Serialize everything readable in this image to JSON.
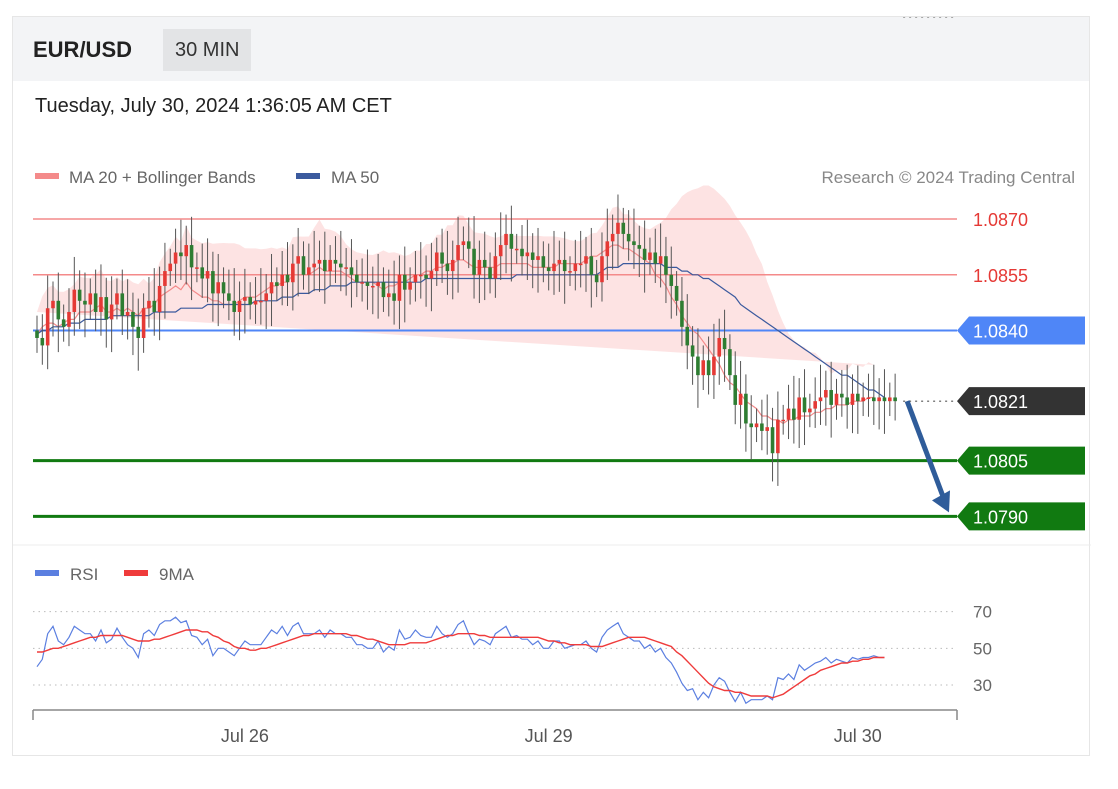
{
  "header": {
    "pair": "EUR/USD",
    "timeframe": "30 MIN",
    "datetime": "Tuesday, July 30, 2024 1:36:05 AM CET"
  },
  "legend": {
    "ma20": "MA 20 + Bollinger Bands",
    "ma50": "MA 50",
    "copyright": "Research © 2024 Trading Central",
    "rsi": "RSI",
    "rsi_ma": "9MA"
  },
  "colors": {
    "candle_up": "#e53935",
    "candle_down": "#2e7d32",
    "ma20": "#f48a8a",
    "band_fill": "#fde0e0",
    "ma50": "#3b5a9e",
    "resistance": "#f48a8a",
    "pivot": "#4f86f7",
    "support": "#117a11",
    "last": "#333333",
    "arrow": "#2f5c9a",
    "rsi": "#5b7fe0",
    "rsi_ma": "#ef3b3b"
  },
  "levels": [
    {
      "value": 1.087,
      "label": "1.0870",
      "type": "resistance"
    },
    {
      "value": 1.0855,
      "label": "1.0855",
      "type": "resistance"
    },
    {
      "value": 1.084,
      "label": "1.0840",
      "type": "pivot"
    },
    {
      "value": 1.0821,
      "label": "1.0821",
      "type": "last"
    },
    {
      "value": 1.0805,
      "label": "1.0805",
      "type": "support"
    },
    {
      "value": 1.079,
      "label": "1.0790",
      "type": "support"
    }
  ],
  "chart_data": [
    {
      "type": "candlestick",
      "title": "EUR/USD",
      "x_ticks": [
        {
          "label": "Jul 26",
          "index": 39
        },
        {
          "label": "Jul 29",
          "index": 96
        },
        {
          "label": "Jul 30",
          "index": 154
        }
      ],
      "ohlc_series": {
        "name": "EUR/USD",
        "closes": [
          1.0838,
          1.0836,
          1.0846,
          1.0848,
          1.0843,
          1.0841,
          1.0845,
          1.0851,
          1.0848,
          1.0847,
          1.085,
          1.0845,
          1.0849,
          1.0843,
          1.0847,
          1.085,
          1.0844,
          1.0845,
          1.0841,
          1.0838,
          1.0846,
          1.0848,
          1.0845,
          1.0852,
          1.0856,
          1.0858,
          1.0861,
          1.086,
          1.0863,
          1.0857,
          1.0857,
          1.0854,
          1.0856,
          1.085,
          1.0853,
          1.085,
          1.0848,
          1.0845,
          1.0848,
          1.0849,
          1.0847,
          1.0848,
          1.0848,
          1.085,
          1.0853,
          1.0852,
          1.0855,
          1.0853,
          1.0858,
          1.086,
          1.0855,
          1.0857,
          1.0858,
          1.0859,
          1.0856,
          1.0859,
          1.0858,
          1.0857,
          1.0857,
          1.0855,
          1.0853,
          1.0853,
          1.0852,
          1.0852,
          1.0853,
          1.0849,
          1.085,
          1.0848,
          1.0855,
          1.0851,
          1.0853,
          1.0855,
          1.0855,
          1.0854,
          1.0856,
          1.0861,
          1.0858,
          1.0856,
          1.0859,
          1.0863,
          1.0864,
          1.0862,
          1.0855,
          1.0859,
          1.0857,
          1.0854,
          1.086,
          1.0863,
          1.0866,
          1.0862,
          1.0862,
          1.086,
          1.0861,
          1.0859,
          1.086,
          1.0857,
          1.0856,
          1.0858,
          1.0859,
          1.0856,
          1.0856,
          1.0858,
          1.0858,
          1.086,
          1.0855,
          1.0853,
          1.086,
          1.0864,
          1.0866,
          1.0869,
          1.0866,
          1.0864,
          1.0863,
          1.0862,
          1.0859,
          1.0861,
          1.0858,
          1.086,
          1.0855,
          1.0852,
          1.0848,
          1.0841,
          1.0836,
          1.0833,
          1.0828,
          1.0832,
          1.0828,
          1.0833,
          1.0838,
          1.0835,
          1.0828,
          1.082,
          1.0823,
          1.0815,
          1.0814,
          1.0815,
          1.0813,
          1.0814,
          1.0807,
          1.0816,
          1.0816,
          1.0819,
          1.0816,
          1.0822,
          1.0818,
          1.0819,
          1.0821,
          1.0822,
          1.0824,
          1.082,
          1.0823,
          1.0822,
          1.082,
          1.0823,
          1.0821,
          1.0822,
          1.0822,
          1.0821,
          1.0822,
          1.0821,
          1.0822,
          1.0821
        ],
        "y_range": [
          1.0778,
          1.0884
        ]
      },
      "lines": [
        {
          "name": "MA 20",
          "values": [
            1.0839,
            1.0841,
            1.0842,
            1.0842,
            1.0841,
            1.0842,
            1.0843,
            1.0843,
            1.0845,
            1.0845,
            1.0845,
            1.0846,
            1.0847,
            1.0845,
            1.0845,
            1.0846,
            1.0845,
            1.0846,
            1.0845,
            1.0844,
            1.0846,
            1.0846,
            1.0847,
            1.0849,
            1.085,
            1.0851,
            1.0852,
            1.0851,
            1.0853,
            1.0851,
            1.085,
            1.0849,
            1.0849,
            1.0848,
            1.0848,
            1.0847,
            1.0847,
            1.0847,
            1.0848,
            1.0849,
            1.0849,
            1.0849,
            1.085,
            1.0851,
            1.0852,
            1.0852,
            1.0853,
            1.0853,
            1.0855,
            1.0855,
            1.0855,
            1.0855,
            1.0856,
            1.0857,
            1.0856,
            1.0856,
            1.0856,
            1.0856,
            1.0855,
            1.0854,
            1.0853,
            1.0853,
            1.0853,
            1.0853,
            1.0852,
            1.0851,
            1.0852,
            1.0852,
            1.0853,
            1.0853,
            1.0854,
            1.0855,
            1.0855,
            1.0856,
            1.0856,
            1.0857,
            1.0857,
            1.0858,
            1.0858,
            1.0859,
            1.0859,
            1.0858,
            1.0857,
            1.0857,
            1.0857,
            1.0857,
            1.0857,
            1.0858,
            1.0858,
            1.0858,
            1.0858,
            1.0858,
            1.0858,
            1.0857,
            1.0857,
            1.0857,
            1.0857,
            1.0857,
            1.0858,
            1.0858,
            1.0858,
            1.0858,
            1.0858,
            1.0859,
            1.086,
            1.086,
            1.0861,
            1.0862,
            1.0863,
            1.0863,
            1.0862,
            1.0862,
            1.0861,
            1.086,
            1.0859,
            1.0858,
            1.0855,
            1.0854,
            1.0852,
            1.0849,
            1.0847,
            1.0844,
            1.0842,
            1.084,
            1.0839,
            1.0837,
            1.0835,
            1.0833,
            1.0831,
            1.0828,
            1.0826,
            1.0825,
            1.0823,
            1.0821,
            1.082,
            1.0819,
            1.0817,
            1.0817,
            1.0816,
            1.0816,
            1.0815,
            1.0816,
            1.0816,
            1.0817,
            1.0817,
            1.0817,
            1.0818,
            1.0818,
            1.0819,
            1.0819,
            1.082,
            1.082,
            1.082,
            1.0821,
            1.0821,
            1.0821,
            1.0822,
            1.0822
          ]
        },
        {
          "name": "MA 50",
          "values": [
            1.0839,
            1.084,
            1.084,
            1.0841,
            1.0841,
            1.0841,
            1.0842,
            1.0842,
            1.0842,
            1.0843,
            1.0843,
            1.0843,
            1.0843,
            1.0843,
            1.0844,
            1.0844,
            1.0844,
            1.0844,
            1.0844,
            1.0844,
            1.0844,
            1.0844,
            1.0845,
            1.0845,
            1.0845,
            1.0845,
            1.0845,
            1.0846,
            1.0846,
            1.0846,
            1.0846,
            1.0846,
            1.0847,
            1.0847,
            1.0847,
            1.0847,
            1.0847,
            1.0847,
            1.0847,
            1.0847,
            1.0847,
            1.0848,
            1.0848,
            1.0848,
            1.0848,
            1.0848,
            1.0849,
            1.0849,
            1.0849,
            1.085,
            1.085,
            1.085,
            1.0851,
            1.0851,
            1.0851,
            1.0852,
            1.0852,
            1.0852,
            1.0852,
            1.0853,
            1.0853,
            1.0853,
            1.0853,
            1.0853,
            1.0853,
            1.0853,
            1.0853,
            1.0853,
            1.0853,
            1.0853,
            1.0853,
            1.0853,
            1.0853,
            1.0854,
            1.0854,
            1.0854,
            1.0854,
            1.0854,
            1.0854,
            1.0854,
            1.0854,
            1.0854,
            1.0854,
            1.0854,
            1.0854,
            1.0854,
            1.0854,
            1.0854,
            1.0854,
            1.0854,
            1.0855,
            1.0855,
            1.0855,
            1.0855,
            1.0855,
            1.0855,
            1.0855,
            1.0855,
            1.0855,
            1.0855,
            1.0855,
            1.0855,
            1.0855,
            1.0855,
            1.0855,
            1.0855,
            1.0856,
            1.0857,
            1.0857,
            1.0857,
            1.0858,
            1.0858,
            1.0858,
            1.0858,
            1.0858,
            1.0858,
            1.0858,
            1.0858,
            1.0857,
            1.0857,
            1.0857,
            1.0856,
            1.0856,
            1.0855,
            1.0855,
            1.0854,
            1.0854,
            1.0853,
            1.0852,
            1.0851,
            1.085,
            1.0849,
            1.0847,
            1.0846,
            1.0845,
            1.0844,
            1.0843,
            1.0842,
            1.0841,
            1.084,
            1.0839,
            1.0838,
            1.0837,
            1.0836,
            1.0835,
            1.0834,
            1.0833,
            1.0832,
            1.0831,
            1.083,
            1.0829,
            1.0828,
            1.0828,
            1.0827,
            1.0826,
            1.0825,
            1.0824,
            1.0824,
            1.0823,
            1.0822
          ]
        }
      ],
      "arrow": {
        "from_value": 1.0821,
        "to_value": 1.079
      }
    },
    {
      "type": "line",
      "title": "RSI",
      "y_ticks": [
        70,
        50,
        30
      ],
      "ylim": [
        18,
        78
      ],
      "series": [
        {
          "name": "RSI",
          "values": [
            40,
            44,
            58,
            62,
            54,
            52,
            56,
            62,
            60,
            58,
            58,
            54,
            60,
            53,
            55,
            61,
            56,
            52,
            50,
            45,
            58,
            60,
            57,
            63,
            65,
            65,
            67,
            64,
            65,
            57,
            56,
            52,
            55,
            46,
            50,
            50,
            48,
            46,
            50,
            54,
            52,
            52,
            52,
            56,
            60,
            58,
            62,
            57,
            62,
            64,
            58,
            58,
            58,
            60,
            56,
            60,
            58,
            58,
            56,
            56,
            52,
            52,
            50,
            50,
            54,
            48,
            51,
            49,
            60,
            55,
            56,
            60,
            57,
            56,
            56,
            62,
            58,
            56,
            58,
            63,
            65,
            58,
            52,
            55,
            54,
            52,
            58,
            60,
            62,
            56,
            57,
            55,
            55,
            52,
            54,
            50,
            50,
            54,
            54,
            50,
            51,
            52,
            52,
            54,
            50,
            48,
            56,
            60,
            62,
            64,
            58,
            56,
            54,
            54,
            50,
            52,
            48,
            50,
            45,
            42,
            37,
            31,
            27,
            28,
            22,
            26,
            23,
            30,
            34,
            32,
            26,
            21,
            26,
            20,
            22,
            22,
            22,
            24,
            22,
            34,
            33,
            36,
            33,
            41,
            38,
            40,
            42,
            43,
            45,
            42,
            44,
            43,
            42,
            45,
            44,
            45,
            45,
            46,
            45,
            45
          ]
        },
        {
          "name": "9MA",
          "values": [
            48,
            48,
            49,
            50,
            50,
            51,
            52,
            53,
            54,
            55,
            56,
            56,
            57,
            57,
            57,
            57,
            57,
            56,
            55,
            54,
            54,
            54,
            55,
            55,
            56,
            57,
            58,
            59,
            60,
            60,
            60,
            59,
            59,
            57,
            56,
            54,
            53,
            51,
            50,
            50,
            49,
            49,
            50,
            50,
            51,
            52,
            53,
            54,
            55,
            56,
            57,
            57,
            58,
            58,
            58,
            58,
            58,
            58,
            58,
            57,
            57,
            56,
            55,
            55,
            54,
            53,
            52,
            52,
            52,
            52,
            53,
            53,
            53,
            53,
            54,
            55,
            56,
            57,
            57,
            58,
            58,
            58,
            58,
            57,
            57,
            56,
            56,
            56,
            56,
            56,
            56,
            56,
            56,
            56,
            56,
            55,
            54,
            54,
            53,
            53,
            52,
            52,
            52,
            52,
            51,
            51,
            51,
            52,
            53,
            54,
            55,
            56,
            56,
            56,
            56,
            55,
            54,
            53,
            52,
            51,
            48,
            46,
            43,
            40,
            37,
            34,
            31,
            29,
            28,
            27,
            27,
            26,
            26,
            25,
            24,
            24,
            24,
            24,
            23,
            24,
            25,
            27,
            29,
            31,
            33,
            35,
            36,
            38,
            39,
            40,
            41,
            42,
            42,
            43,
            43,
            44,
            44,
            45,
            45,
            45
          ]
        }
      ]
    }
  ]
}
